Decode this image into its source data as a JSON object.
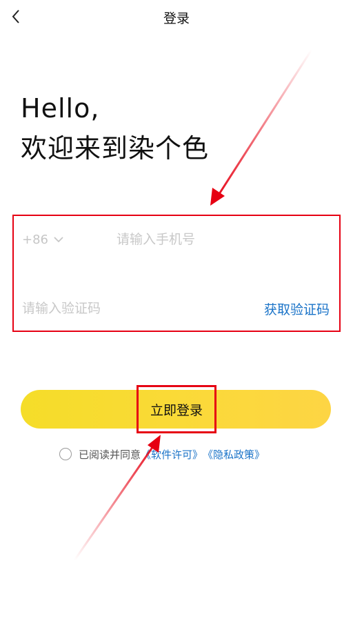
{
  "header": {
    "back_icon": "chevron-left-icon",
    "title": "登录"
  },
  "greeting": {
    "line1": "Hello,",
    "line2": "欢迎来到染个色"
  },
  "form": {
    "country_code": "+86",
    "country_code_icon": "chevron-down-icon",
    "phone_placeholder": "请输入手机号",
    "code_placeholder": "请输入验证码",
    "get_code_label": "获取验证码"
  },
  "login_button": {
    "label": "立即登录"
  },
  "agreement": {
    "prefix": "已阅读并同意",
    "license_link": "《软件许可》",
    "privacy_link": "《隐私政策》"
  },
  "colors": {
    "accent_yellow": "#f8d832",
    "link_blue": "#1a73c8",
    "annotation_red": "#e60012"
  }
}
